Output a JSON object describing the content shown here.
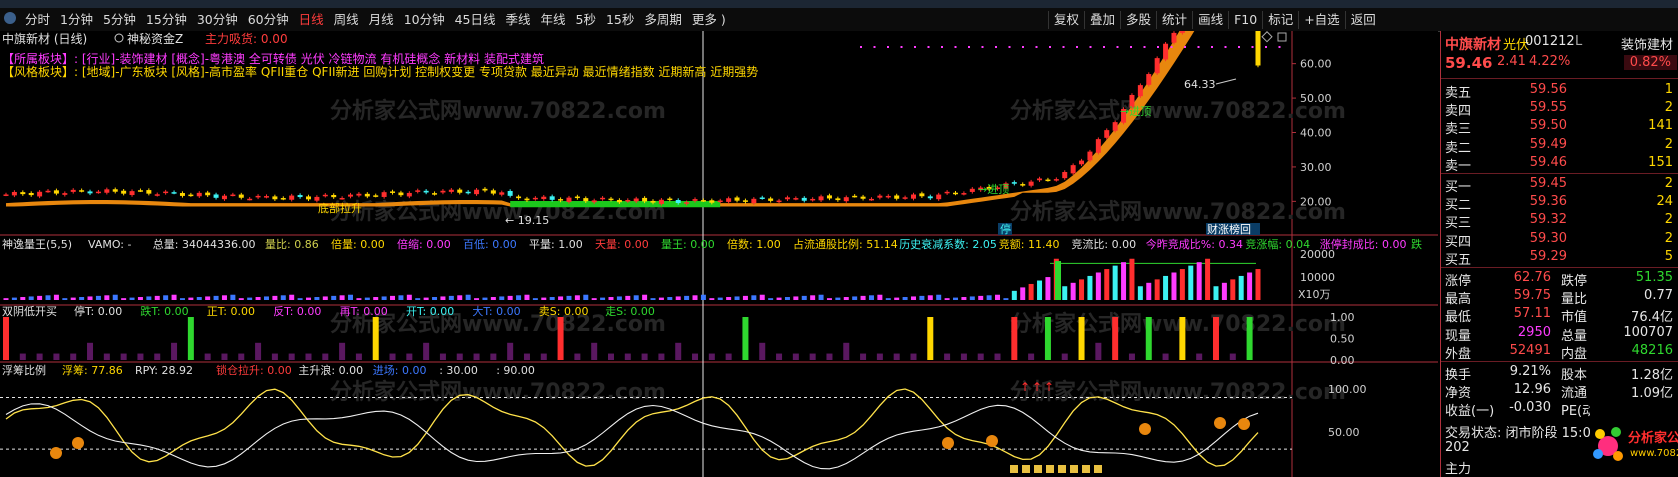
{
  "menubar": {
    "periods": [
      "分时",
      "1分钟",
      "5分钟",
      "15分钟",
      "30分钟",
      "60分钟",
      "日线",
      "周线",
      "月线",
      "10分钟",
      "45日线",
      "季线",
      "年线",
      "5秒",
      "15秒",
      "多周期",
      "更多 )"
    ],
    "active_period": "日线",
    "tools": [
      "复权",
      "叠加",
      "多股",
      "统计",
      "画线",
      "F10",
      "标记",
      "+自选",
      "返回"
    ]
  },
  "main_panel": {
    "title": "中旗新材 (日线)",
    "indicator": "神秘资金Z",
    "indicator_value": "主力吸货: 0.00",
    "sector_line1": "【所属板块】: [行业]-装饰建材 [概念]-粤港澳 全可转债 光伏 冷链物流 有机硅概念 新材料 装配式建筑",
    "sector_line2": "【风格板块】: [地域]-广东板块 [风格]-高市盈率 QFII重仓 QFII新进 回购计划 控制权变更 专项贷款 最近异动 最近情绪指数 近期新高 近期强势",
    "high_label": "64.33",
    "low_label": "19.15",
    "label_bottom": "底部拉升",
    "label_jinding1": "进顶",
    "label_jinding2": "进顶",
    "label_ting": "停",
    "label_caizhang": "财涨榜回",
    "y_ticks": [
      "60.00",
      "50.00",
      "40.00",
      "30.00",
      "20.00"
    ]
  },
  "volume_panel": {
    "title": "神逸量王(5,5)",
    "fields": [
      {
        "label": "VAMO: -",
        "value": "",
        "color": "#e0e0e0"
      },
      {
        "label": "总量: ",
        "value": "34044336.00",
        "color": "#e0e0e0"
      },
      {
        "label": "量比: ",
        "value": "0.86",
        "color": "#cfcf4e"
      },
      {
        "label": "倍量: ",
        "value": "0.00",
        "color": "#ffd700"
      },
      {
        "label": "倍缩: ",
        "value": "0.00",
        "color": "#ff3cff"
      },
      {
        "label": "百低: ",
        "value": "0.00",
        "color": "#3c78ff"
      },
      {
        "label": "平量: ",
        "value": "1.00",
        "color": "#e0e0e0"
      },
      {
        "label": "天量: ",
        "value": "0.00",
        "color": "#ff3c3c"
      },
      {
        "label": "量王: ",
        "value": "0.00",
        "color": "#2fd82f"
      },
      {
        "label": "倍数: ",
        "value": "1.00",
        "color": "#ffd700"
      },
      {
        "label": "占流通股比例: ",
        "value": "51.14",
        "color": "#ffd700"
      },
      {
        "label": "历史衰减系数: ",
        "value": "2.05",
        "color": "#3cf2f2"
      },
      {
        "label": "竞额: ",
        "value": "11.40",
        "color": "#ffd700"
      },
      {
        "label": "竞流比: ",
        "value": "0.00",
        "color": "#e0e0e0"
      },
      {
        "label": "今昨竞成比%: ",
        "value": "0.34",
        "color": "#ff3cff"
      },
      {
        "label": "竞涨幅: ",
        "value": "0.04",
        "color": "#2fd82f"
      },
      {
        "label": "涨停封成比: ",
        "value": "0.00",
        "color": "#ff3cff"
      },
      {
        "label": "跌",
        "value": "",
        "color": "#2fd82f"
      }
    ],
    "y_ticks": [
      "20000",
      "10000"
    ],
    "unit": "X10万"
  },
  "signal_panel": {
    "title": "双阴低开买",
    "fields": [
      {
        "label": "停T: ",
        "value": "0.00",
        "color": "#e0e0e0"
      },
      {
        "label": "跌T: ",
        "value": "0.00",
        "color": "#2fd82f"
      },
      {
        "label": "正T: ",
        "value": "0.00",
        "color": "#ffd700"
      },
      {
        "label": "反T: ",
        "value": "0.00",
        "color": "#ff3cff"
      },
      {
        "label": "再T: ",
        "value": "0.00",
        "color": "#ff3cff"
      },
      {
        "label": "开T: ",
        "value": "0.00",
        "color": "#3cf2f2"
      },
      {
        "label": "大T: ",
        "value": "0.00",
        "color": "#3c78ff"
      },
      {
        "label": "卖S: ",
        "value": "0.00",
        "color": "#ffd700"
      },
      {
        "label": "走S: ",
        "value": "0.00",
        "color": "#2fd82f"
      }
    ],
    "y_ticks": [
      "1.00",
      "0.50",
      "0.00"
    ]
  },
  "chip_panel": {
    "title": "浮筹比例",
    "fields": [
      {
        "label": "浮筹: ",
        "value": "77.86",
        "color": "#ffd700"
      },
      {
        "label": "RPY: ",
        "value": "28.92",
        "color": "#e0e0e0"
      },
      {
        "label": "锁仓拉升: ",
        "value": "0.00",
        "color": "#ff3c3c"
      },
      {
        "label": "主升浪: ",
        "value": "0.00",
        "color": "#e0e0e0"
      },
      {
        "label": "进场: ",
        "value": "0.00",
        "color": "#3c78ff"
      },
      {
        "label": ": ",
        "value": "30.00",
        "color": "#e0e0e0"
      },
      {
        "label": ": ",
        "value": "90.00",
        "color": "#e0e0e0"
      }
    ],
    "y_ticks": [
      "100.00",
      "50.00"
    ]
  },
  "quote": {
    "name": "中旗新材",
    "tag": "光伏",
    "code": "001212",
    "sector": "装饰建材",
    "sector_change": "0.82%",
    "price": "59.46",
    "change": "2.41",
    "change_pct": "4.22%",
    "asks": [
      {
        "label": "卖五",
        "price": "59.56",
        "vol": "1"
      },
      {
        "label": "卖四",
        "price": "59.55",
        "vol": "2"
      },
      {
        "label": "卖三",
        "price": "59.50",
        "vol": "141"
      },
      {
        "label": "卖二",
        "price": "59.49",
        "vol": "2"
      },
      {
        "label": "卖一",
        "price": "59.46",
        "vol": "151"
      }
    ],
    "bids": [
      {
        "label": "买一",
        "price": "59.45",
        "vol": "2"
      },
      {
        "label": "买二",
        "price": "59.36",
        "vol": "24"
      },
      {
        "label": "买三",
        "price": "59.32",
        "vol": "2"
      },
      {
        "label": "买四",
        "price": "59.30",
        "vol": "2"
      },
      {
        "label": "买五",
        "price": "59.29",
        "vol": "5"
      }
    ],
    "stats": [
      {
        "l1": "涨停",
        "v1": "62.76",
        "c1": "red",
        "l2": "跌停",
        "v2": "51.35",
        "c2": "green"
      },
      {
        "l1": "最高",
        "v1": "59.75",
        "c1": "red",
        "l2": "量比",
        "v2": "0.77",
        "c2": "white"
      },
      {
        "l1": "最低",
        "v1": "57.11",
        "c1": "red",
        "l2": "市值",
        "v2": "76.4亿",
        "c2": "white"
      },
      {
        "l1": "现量",
        "v1": "2950",
        "c1": "magenta",
        "l2": "总量",
        "v2": "100707",
        "c2": "white"
      },
      {
        "l1": "外盘",
        "v1": "52491",
        "c1": "red",
        "l2": "内盘",
        "v2": "48216",
        "c2": "green"
      }
    ],
    "stats2": [
      {
        "l1": "换手",
        "v1": "9.21%",
        "l2": "股本",
        "v2": "1.28亿"
      },
      {
        "l1": "净资",
        "v1": "12.96",
        "l2": "流通",
        "v2": "1.09亿"
      },
      {
        "l1": "收益(一)",
        "v1": "-0.030",
        "l2": "PE(动)",
        "v2": ""
      }
    ],
    "trade_state": "交易状态: 闭市阶段 15:00:00",
    "partial1": "202",
    "partial2": "主力",
    "logo_text": "分析家公式网",
    "logo_url": "www.70822.com"
  },
  "watermark": "分析家公式网www.70822.com"
}
